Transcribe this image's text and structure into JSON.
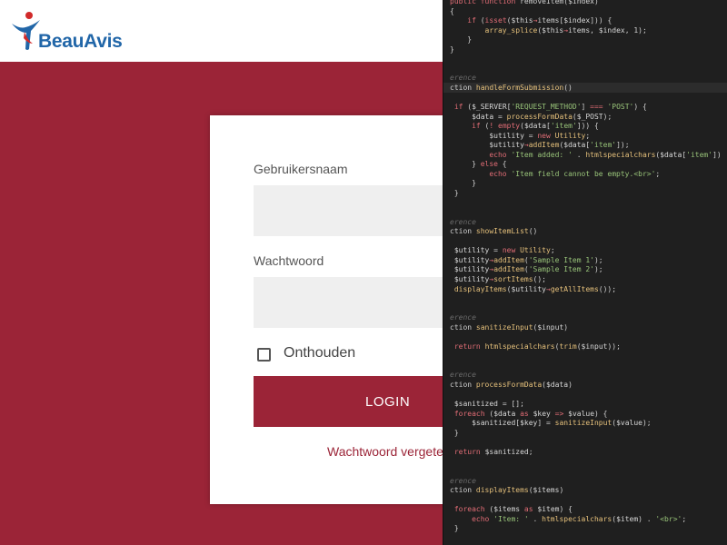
{
  "brand": {
    "name": "BeauAvis",
    "primary_color": "#9b2437",
    "logo_text_color": "#2166a8"
  },
  "login_form": {
    "username_label": "Gebruikersnaam",
    "username_value": "",
    "password_label": "Wachtwoord",
    "password_value": "",
    "remember_label": "Onthouden",
    "remember_checked": false,
    "login_button": "LOGIN",
    "forgot_password_link": "Wachtwoord vergeten?"
  },
  "editor": {
    "code_lines": [
      "public function removeItem($index)",
      "{",
      "    if (isset($this→items[$index])) {",
      "        array_splice($this→items, $index, 1);",
      "    }",
      "}",
      "",
      "",
      "erence",
      "ction handleFormSubmission()",
      "",
      " if ($_SERVER['REQUEST_METHOD'] === 'POST') {",
      "     $data = processFormData($_POST);",
      "     if (! empty($data['item'])) {",
      "         $utility = new Utility;",
      "         $utility→addItem($data['item']);",
      "         echo 'Item added: ' . htmlspecialchars($data['item']) . '<br>",
      "     } else {",
      "         echo 'Item field cannot be empty.<br>';",
      "     }",
      " }",
      "",
      "",
      "erence",
      "ction showItemList()",
      "",
      " $utility = new Utility;",
      " $utility→addItem('Sample Item 1');",
      " $utility→addItem('Sample Item 2');",
      " $utility→sortItems();",
      " displayItems($utility→getAllItems());",
      "",
      "",
      "erence",
      "ction sanitizeInput($input)",
      "",
      " return htmlspecialchars(trim($input));",
      "",
      "",
      "erence",
      "ction processFormData($data)",
      "",
      " $sanitized = [];",
      " foreach ($data as $key => $value) {",
      "     $sanitized[$key] = sanitizeInput($value);",
      " }",
      "",
      " return $sanitized;",
      "",
      "",
      "erence",
      "ction displayItems($items)",
      "",
      " foreach ($items as $item) {",
      "     echo 'Item: ' . htmlspecialchars($item) . '<br>';",
      " }"
    ]
  }
}
